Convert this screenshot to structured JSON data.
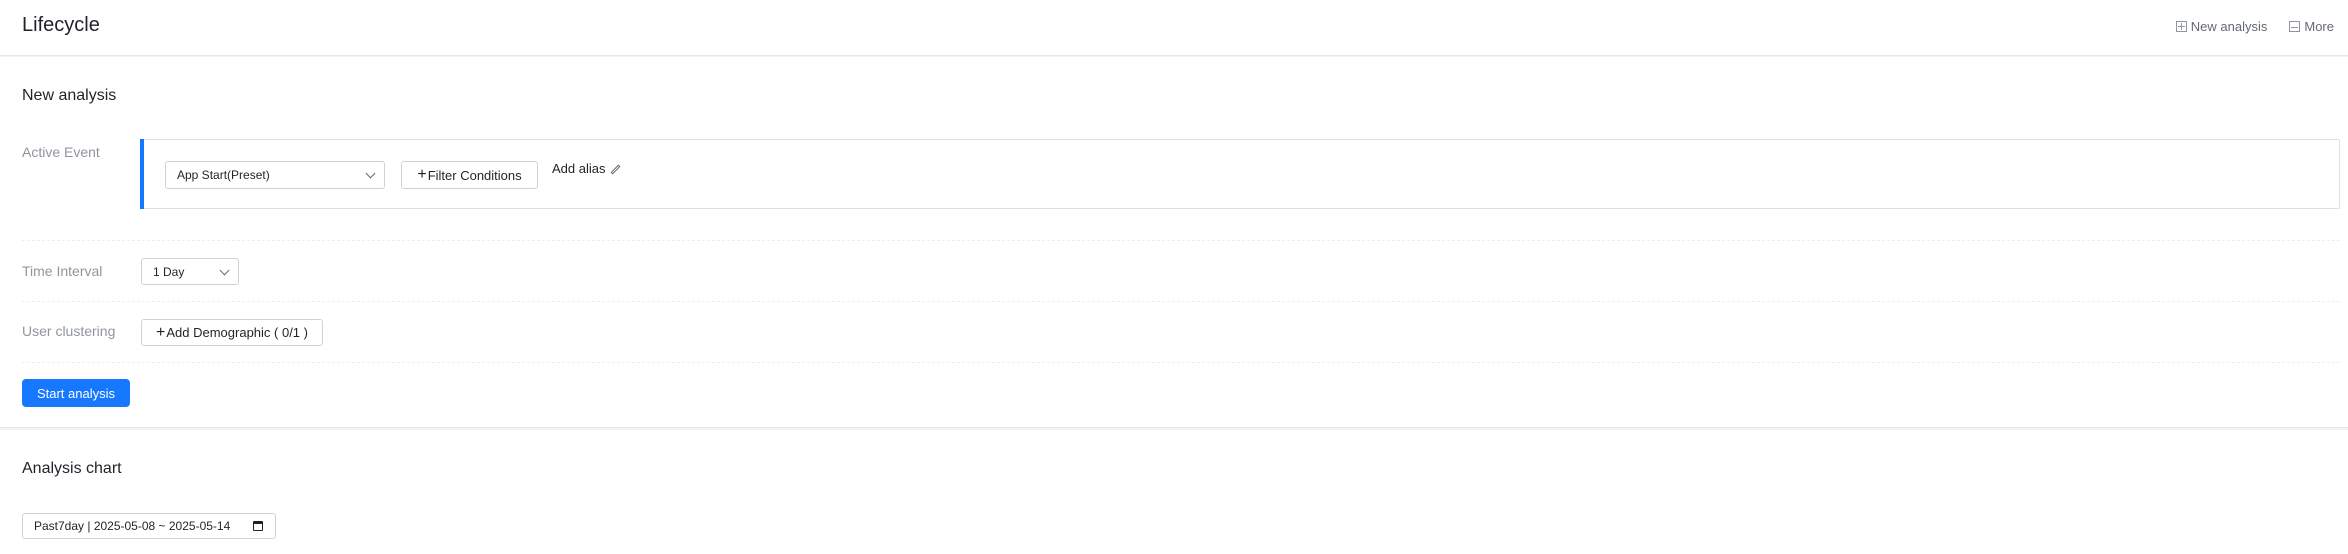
{
  "header": {
    "title": "Lifecycle",
    "actions": [
      {
        "label": "New analysis",
        "icon": "add-analysis-icon"
      },
      {
        "label": "More",
        "icon": "more-icon"
      }
    ]
  },
  "new_analysis": {
    "title": "New analysis",
    "active_event": {
      "label": "Active Event",
      "event_select_value": "App Start(Preset)",
      "filter_button": "Filter Conditions",
      "alias_label": "Add alias"
    },
    "time_interval": {
      "label": "Time Interval",
      "value": "1 Day"
    },
    "user_clustering": {
      "label": "User clustering",
      "button": "Add Demographic ( 0/1 )"
    },
    "start_button": "Start analysis"
  },
  "analysis_chart": {
    "title": "Analysis chart",
    "date_range": "Past7day | 2025-05-08 ~ 2025-05-14"
  },
  "colors": {
    "accent": "#1677ff",
    "text": "#1f2329",
    "muted": "#8f959e",
    "border": "#d0d3d6"
  }
}
